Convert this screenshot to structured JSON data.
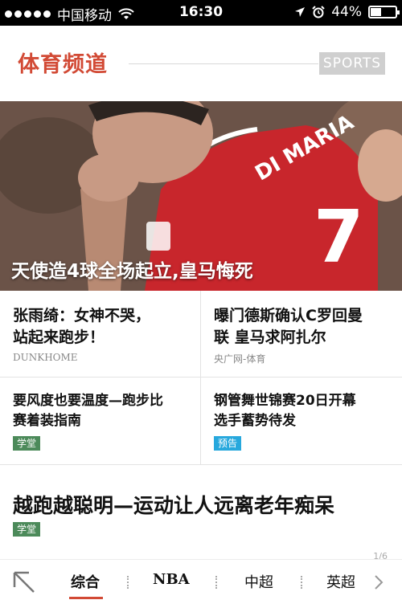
{
  "status_bar": {
    "carrier": "中国移动",
    "time": "16:30",
    "battery": "44%",
    "battery_level": 0.44
  },
  "header": {
    "title": "体育频道",
    "tag": "SPORTS"
  },
  "hero": {
    "caption": "天使造4球全场起立,皇马悔死",
    "jersey_text": "DI MARIA",
    "jersey_number": "7"
  },
  "news": [
    {
      "title_line1": "张雨绮：女神不哭，",
      "title_line2": "站起来跑步！",
      "source": "DUNKHOME"
    },
    {
      "title_line1": "曝门德斯确认C罗回曼",
      "title_line2": "联 皇马求阿扎尔",
      "source": "央广网-体育"
    },
    {
      "title_line1": "要风度也要温度—跑步比",
      "title_line2": "赛着装指南",
      "badge": "学堂"
    },
    {
      "title_line1": "钢管舞世锦赛20日开幕",
      "title_line2": "选手蓄势待发",
      "badge": "预告"
    }
  ],
  "featured": {
    "title": "越跑越聪明—运动让人远离老年痴呆",
    "badge": "学堂"
  },
  "pager": "1/6",
  "tabs": [
    {
      "label": "综合",
      "active": true
    },
    {
      "label": "NBA",
      "active": false
    },
    {
      "label": "中超",
      "active": false
    },
    {
      "label": "英超",
      "active": false
    }
  ],
  "colors": {
    "accent": "#d24a35",
    "badge_green": "#4c8a5a",
    "badge_blue": "#27a8dd"
  },
  "icons": [
    "signal-dots-icon",
    "wifi-icon",
    "location-arrow-icon",
    "alarm-icon",
    "battery-icon",
    "back-arrow-icon",
    "chevron-right-icon"
  ]
}
